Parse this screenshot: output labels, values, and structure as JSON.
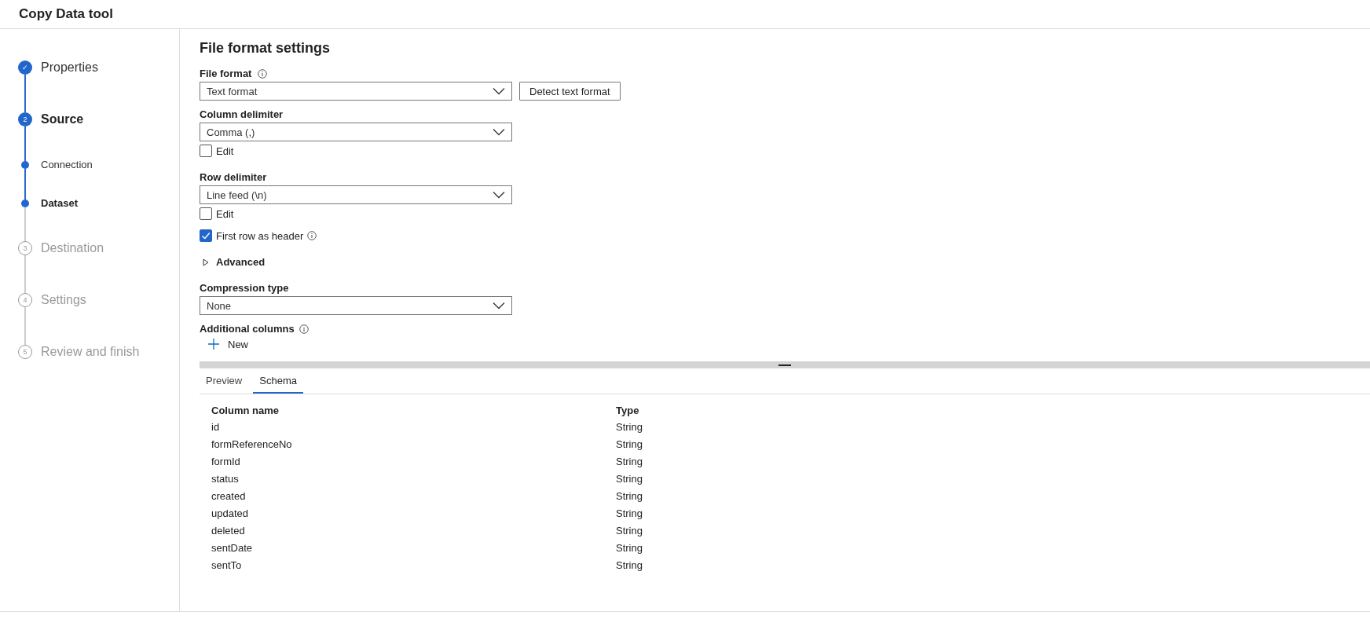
{
  "window": {
    "title": "Copy Data tool"
  },
  "steps": [
    {
      "kind": "step",
      "marker": "✓",
      "label": "Properties",
      "reached": true,
      "current": false
    },
    {
      "kind": "step",
      "marker": "2",
      "label": "Source",
      "reached": true,
      "current": true
    },
    {
      "kind": "substep",
      "label": "Connection",
      "reached": true,
      "current": false
    },
    {
      "kind": "substep",
      "label": "Dataset",
      "reached": true,
      "current": true
    },
    {
      "kind": "step",
      "marker": "3",
      "label": "Destination",
      "reached": false,
      "current": false
    },
    {
      "kind": "step",
      "marker": "4",
      "label": "Settings",
      "reached": false,
      "current": false
    },
    {
      "kind": "step",
      "marker": "5",
      "label": "Review and finish",
      "reached": false,
      "current": false
    }
  ],
  "form": {
    "title": "File format settings",
    "items": [
      {
        "kind": "select",
        "label": "File format",
        "info": true,
        "value": "Text format",
        "button": "Detect text format"
      },
      {
        "kind": "select",
        "label": "Column delimiter",
        "value": "Comma (,)"
      },
      {
        "kind": "checkbox",
        "label": "Edit",
        "checked": false
      },
      {
        "kind": "select",
        "label": "Row delimiter",
        "value": "Line feed (\\n)"
      },
      {
        "kind": "checkbox",
        "label": "Edit",
        "checked": false
      },
      {
        "kind": "checkbox",
        "label": "First row as header",
        "checked": true,
        "info": true
      },
      {
        "kind": "expander",
        "label": "Advanced",
        "expanded": false
      },
      {
        "kind": "select",
        "label": "Compression type",
        "value": "None"
      },
      {
        "kind": "heading",
        "label": "Additional columns",
        "info": true
      },
      {
        "kind": "add",
        "label": "New"
      }
    ]
  },
  "tabs": [
    {
      "label": "Preview",
      "selected": false
    },
    {
      "label": "Schema",
      "selected": true
    }
  ],
  "table": {
    "columns": [
      "Column name",
      "Type"
    ],
    "rows": [
      [
        "id",
        "String"
      ],
      [
        "formReferenceNo",
        "String"
      ],
      [
        "formId",
        "String"
      ],
      [
        "status",
        "String"
      ],
      [
        "created",
        "String"
      ],
      [
        "updated",
        "String"
      ],
      [
        "deleted",
        "String"
      ],
      [
        "sentDate",
        "String"
      ],
      [
        "sentTo",
        "String"
      ]
    ]
  }
}
